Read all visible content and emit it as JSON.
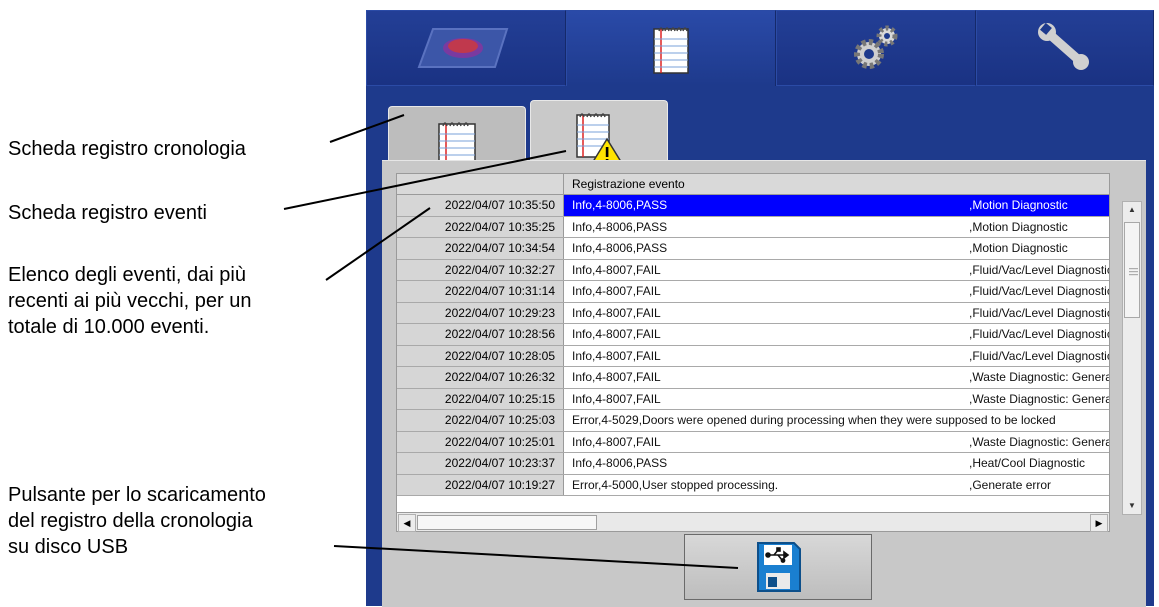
{
  "annotations": {
    "history_tab": "Scheda registro cronologia",
    "event_tab": "Scheda registro eventi",
    "event_list": [
      "Elenco degli eventi, dai più",
      "recenti ai più vecchi, per un",
      "totale di 10.000 eventi."
    ],
    "usb_button": [
      "Pulsante per lo scaricamento",
      "del registro della cronologia",
      "su disco USB"
    ]
  },
  "top_tabs": [
    {
      "icon": "instrument-icon",
      "active": false
    },
    {
      "icon": "notepad-icon",
      "active": true
    },
    {
      "icon": "gears-icon",
      "active": false
    },
    {
      "icon": "wrench-icon",
      "active": false
    }
  ],
  "sub_tabs": [
    {
      "icon": "history-log-icon",
      "active": false
    },
    {
      "icon": "event-log-warning-icon",
      "active": true
    }
  ],
  "grid": {
    "header": "Registrazione evento",
    "rows": [
      {
        "time": "2022/04/07 10:35:50",
        "msg": "Info,4-8006,PASS",
        "src": ",Motion Diagnostic",
        "selected": true
      },
      {
        "time": "2022/04/07 10:35:25",
        "msg": "Info,4-8006,PASS",
        "src": ",Motion Diagnostic"
      },
      {
        "time": "2022/04/07 10:34:54",
        "msg": "Info,4-8006,PASS",
        "src": ",Motion Diagnostic"
      },
      {
        "time": "2022/04/07 10:32:27",
        "msg": "Info,4-8007,FAIL",
        "src": ",Fluid/Vac/Level Diagnostic"
      },
      {
        "time": "2022/04/07 10:31:14",
        "msg": "Info,4-8007,FAIL",
        "src": ",Fluid/Vac/Level Diagnostic"
      },
      {
        "time": "2022/04/07 10:29:23",
        "msg": "Info,4-8007,FAIL",
        "src": ",Fluid/Vac/Level Diagnostic"
      },
      {
        "time": "2022/04/07 10:28:56",
        "msg": "Info,4-8007,FAIL",
        "src": ",Fluid/Vac/Level Diagnostic"
      },
      {
        "time": "2022/04/07 10:28:05",
        "msg": "Info,4-8007,FAIL",
        "src": ",Fluid/Vac/Level Diagnostic"
      },
      {
        "time": "2022/04/07 10:26:32",
        "msg": "Info,4-8007,FAIL",
        "src": ",Waste Diagnostic: General"
      },
      {
        "time": "2022/04/07 10:25:15",
        "msg": "Info,4-8007,FAIL",
        "src": ",Waste Diagnostic: General"
      },
      {
        "time": "2022/04/07 10:25:03",
        "msg": "Error,4-5029,Doors were opened during processing when they were supposed to be locked",
        "src": ""
      },
      {
        "time": "2022/04/07 10:25:01",
        "msg": "Info,4-8007,FAIL",
        "src": ",Waste Diagnostic: General"
      },
      {
        "time": "2022/04/07 10:23:37",
        "msg": "Info,4-8006,PASS",
        "src": ",Heat/Cool Diagnostic"
      },
      {
        "time": "2022/04/07 10:19:27",
        "msg": "Error,4-5000,User stopped processing.",
        "src": ",Generate error"
      }
    ]
  },
  "usb_button_icon": "usb-floppy-icon",
  "colors": {
    "device_blue": "#1e3a8c",
    "selected_row": "#0000ff",
    "panel_gray": "#c8c8c8"
  }
}
